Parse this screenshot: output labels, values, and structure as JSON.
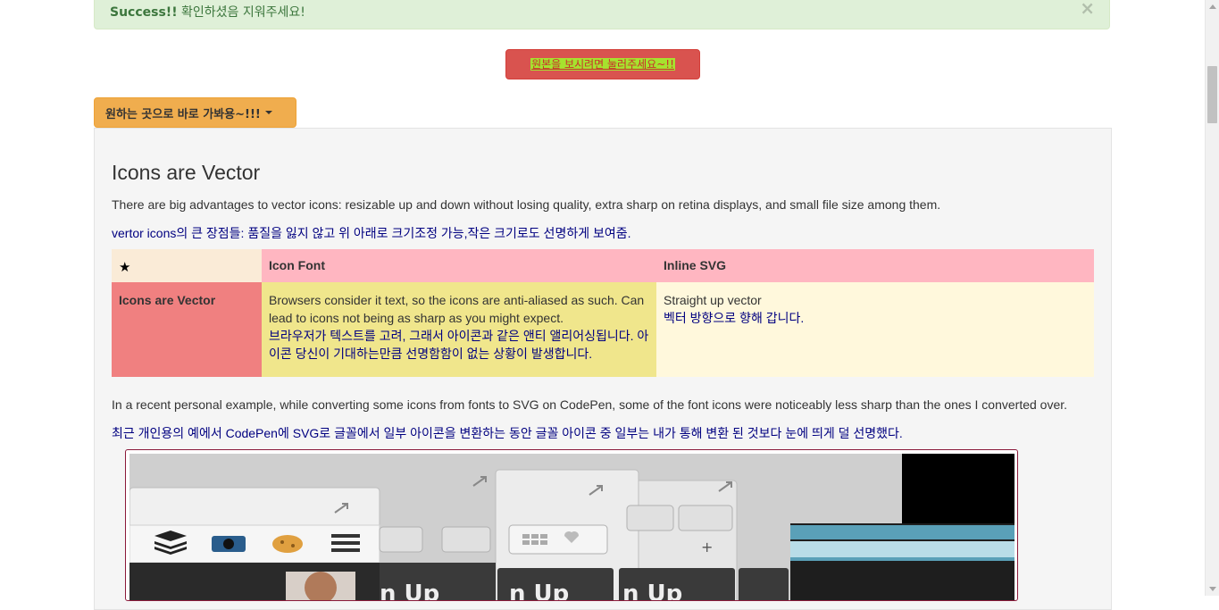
{
  "alert": {
    "strong": "Success!!",
    "text": " 확인하셨음 지워주세요!",
    "close": "×"
  },
  "original_button": {
    "label": "원본을 보시려면 눌러주세요~!!"
  },
  "goto_button": {
    "label": "원하는 곳으로 바로 가봐용~!!!"
  },
  "section": {
    "title": "Icons are Vector",
    "intro_en": "There are big advantages to vector icons: resizable up and down without losing quality, extra sharp on retina displays, and small file size among them.",
    "intro_ko": "vertor icons의 큰 장점들: 품질을 잃지 않고 위 아래로 크기조정 가능,작은 크기로도 선명하게 보여줌."
  },
  "table": {
    "header": {
      "star": "★",
      "icon_font": "Icon Font",
      "inline_svg": "Inline SVG"
    },
    "row": {
      "label": "Icons are Vector",
      "icon_font_en": "Browsers consider it text, so the icons are anti-aliased as such. Can lead to icons not being as sharp as you might expect.",
      "icon_font_ko": "브라우저가 텍스트를 고려, 그래서 아이콘과 같은 앤티 앨리어싱됩니다. 아이콘 당신이 기대하는만큼 선명함함이 없는 상황이 발생합니다.",
      "inline_svg_en": "Straight up vector",
      "inline_svg_ko": "벡터 방향으로 향해 갑니다."
    }
  },
  "example": {
    "en": "In a recent personal example, while converting some icons from fonts to SVG on CodePen, some of the font icons were noticeably less sharp than the ones I converted over.",
    "ko": "최근 개인용의 예에서 CodePen에 SVG로 글꼴에서 일부 아이콘을 변환하는 동안 글꼴 아이콘 중 일부는 내가 통해 변환 된 것보다 눈에 띄게 덜 선명했다."
  },
  "screenshot": {
    "button_text": [
      "n Up",
      "n Up",
      "n Up"
    ],
    "icons": [
      "layers-icon",
      "camera-icon",
      "cookie-icon",
      "menu-icon",
      "refresh-icon",
      "key-icon",
      "grid-icon",
      "heart-icon",
      "plus-icon",
      "expand-icon"
    ]
  }
}
